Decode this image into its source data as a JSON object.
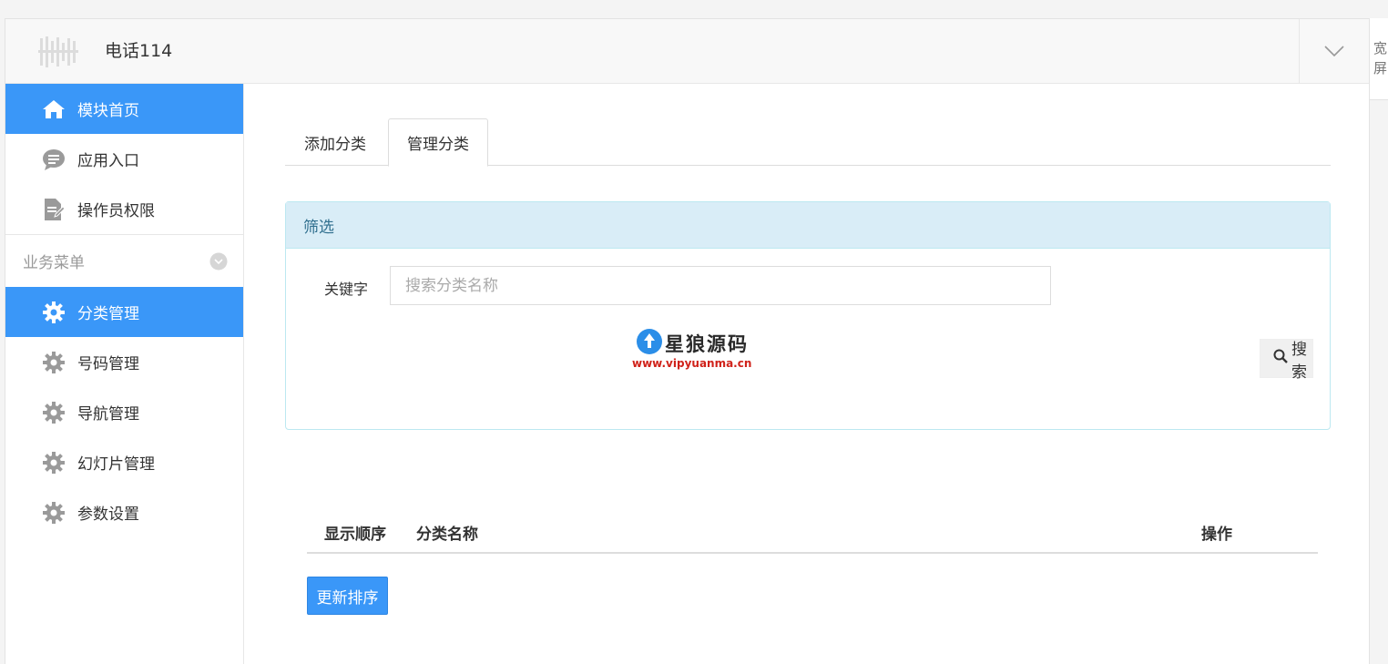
{
  "header": {
    "app_title": "电话114"
  },
  "right_strip": {
    "text": "宽屏"
  },
  "sidebar": {
    "items_top": [
      {
        "label": "模块首页",
        "icon": "home-icon",
        "active": true
      },
      {
        "label": "应用入口",
        "icon": "chat-icon",
        "active": false
      },
      {
        "label": "操作员权限",
        "icon": "edit-doc-icon",
        "active": false
      }
    ],
    "group": {
      "label": "业务菜单"
    },
    "items_group": [
      {
        "label": "分类管理",
        "icon": "gear-icon",
        "active": true
      },
      {
        "label": "号码管理",
        "icon": "gear-icon",
        "active": false
      },
      {
        "label": "导航管理",
        "icon": "gear-icon",
        "active": false
      },
      {
        "label": "幻灯片管理",
        "icon": "gear-icon",
        "active": false
      },
      {
        "label": "参数设置",
        "icon": "gear-icon",
        "active": false
      }
    ]
  },
  "tabs": [
    {
      "label": "添加分类"
    },
    {
      "label": "管理分类"
    }
  ],
  "filter": {
    "title": "筛选",
    "keyword_label": "关键字",
    "keyword_placeholder": "搜索分类名称",
    "keyword_value": "",
    "search_label": "搜索"
  },
  "watermark": {
    "title": "星狼源码",
    "url": "www.vipyuanma.cn"
  },
  "table": {
    "columns": [
      "显示顺序",
      "分类名称",
      "操作"
    ]
  },
  "actions": {
    "update_order_label": "更新排序"
  },
  "colors": {
    "accent": "#3a97f8",
    "panel_head": "#d9edf7"
  }
}
